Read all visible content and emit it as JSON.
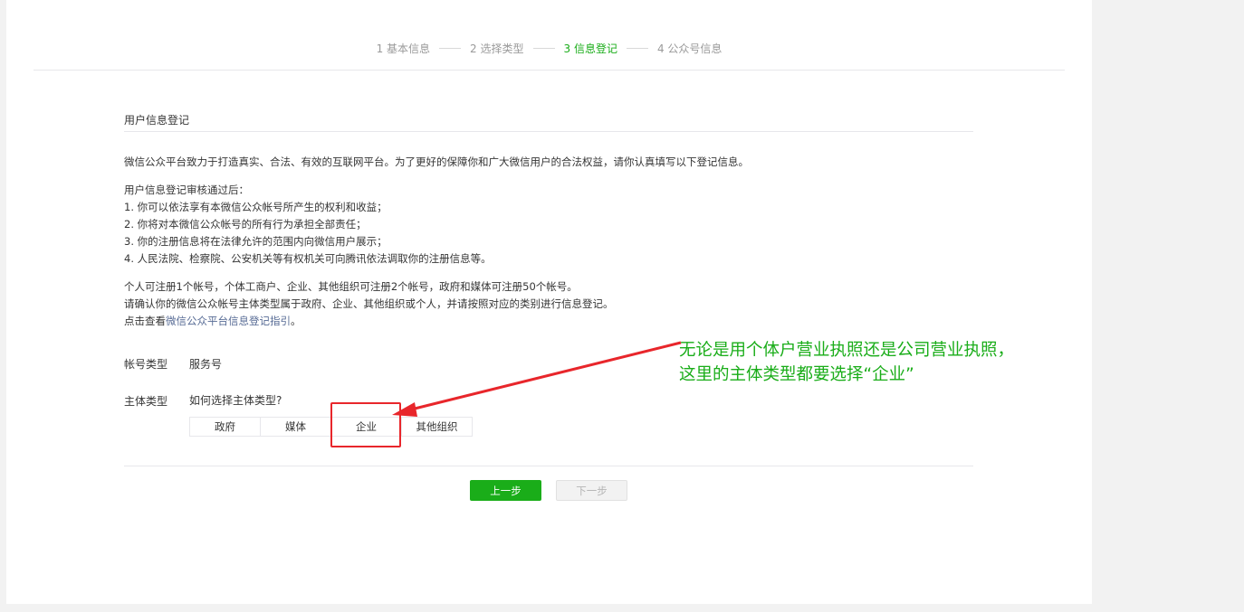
{
  "steps": [
    {
      "label": "1 基本信息",
      "active": false
    },
    {
      "label": "2 选择类型",
      "active": false
    },
    {
      "label": "3 信息登记",
      "active": true
    },
    {
      "label": "4 公众号信息",
      "active": false
    }
  ],
  "section_title": "用户信息登记",
  "intro": "微信公众平台致力于打造真实、合法、有效的互联网平台。为了更好的保障你和广大微信用户的合法权益，请你认真填写以下登记信息。",
  "review": {
    "heading": "用户信息登记审核通过后：",
    "items": [
      "1. 你可以依法享有本微信公众帐号所产生的权利和收益；",
      "2. 你将对本微信公众帐号的所有行为承担全部责任；",
      "3. 你的注册信息将在法律允许的范围内向微信用户展示；",
      "4. 人民法院、检察院、公安机关等有权机关可向腾讯依法调取你的注册信息等。"
    ]
  },
  "notes": {
    "line1": "个人可注册1个帐号，个体工商户、企业、其他组织可注册2个帐号，政府和媒体可注册50个帐号。",
    "line2": "请确认你的微信公众帐号主体类型属于政府、企业、其他组织或个人，并请按照对应的类别进行信息登记。",
    "line3_prefix": "点击查看",
    "line3_link": "微信公众平台信息登记指引",
    "line3_suffix": "。"
  },
  "form": {
    "account_type_label": "帐号类型",
    "account_type_value": "服务号",
    "subject_type_label": "主体类型",
    "subject_help_link": "如何选择主体类型?",
    "subject_options": [
      "政府",
      "媒体",
      "企业",
      "其他组织"
    ]
  },
  "buttons": {
    "prev": "上一步",
    "next": "下一步"
  },
  "annotation": {
    "line1": "无论是用个体户营业执照还是公司营业执照，",
    "line2": "这里的主体类型都要选择“企业”",
    "color": "#1aad19",
    "highlight_color": "#e8262b"
  },
  "colors": {
    "brand_green": "#1aad19",
    "link": "#576b95"
  }
}
